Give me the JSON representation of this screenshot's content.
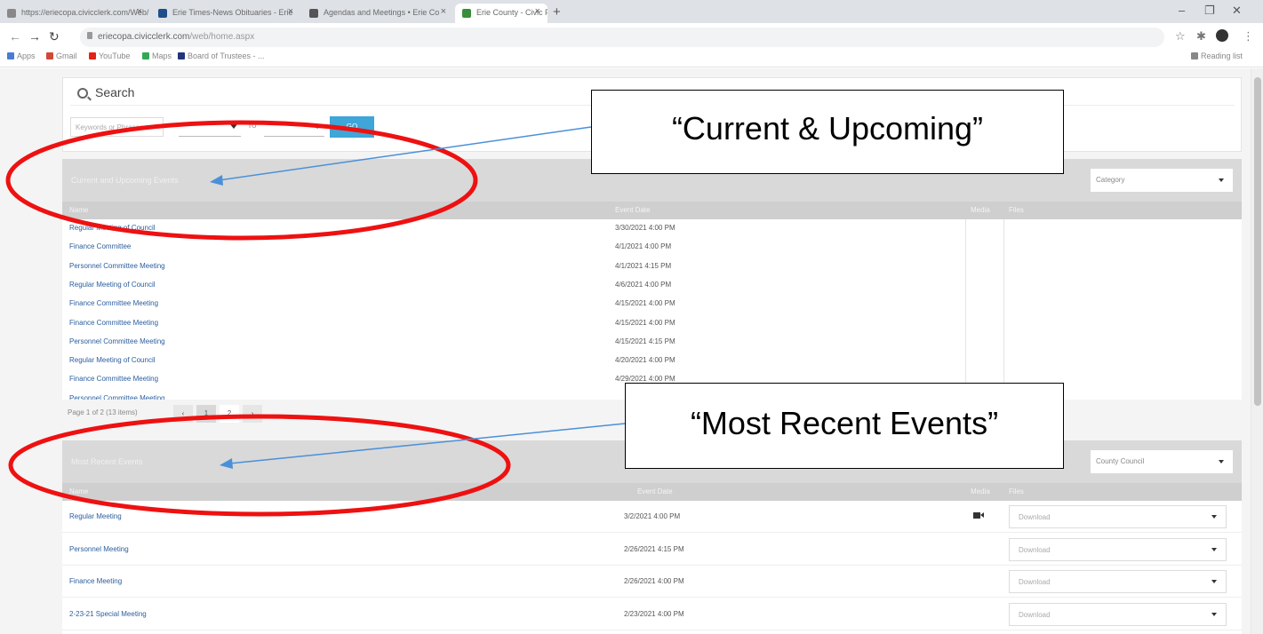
{
  "browser": {
    "tabs": [
      {
        "label": "https://eriecopa.civicclerk.com/Web/",
        "fav": "#888888"
      },
      {
        "label": "Erie Times-News Obituaries - Erie",
        "fav": "#1f4e8c"
      },
      {
        "label": "Agendas and Meetings • Erie Co",
        "fav": "#555555"
      },
      {
        "label": "Erie County - Civic Plus",
        "fav": "#3a8d3a"
      }
    ],
    "new_tab": "+",
    "win_min": "–",
    "win_max": "❐",
    "win_close": "✕",
    "url_prefix": "eriecopa.civicclerk.com",
    "url_path": "/web/home.aspx",
    "bookmarks": [
      {
        "label": "Apps",
        "color": "#4a7bd4"
      },
      {
        "label": "Gmail",
        "color": "#d44638"
      },
      {
        "label": "YouTube",
        "color": "#e62117"
      },
      {
        "label": "Maps",
        "color": "#34a853"
      },
      {
        "label": "Board of Trustees - ...",
        "color": "#22357a"
      }
    ],
    "reading_list": "Reading list"
  },
  "search": {
    "title": "Search",
    "keyword_placeholder": "Keywords or Phrases",
    "to_label": "To",
    "go_label": "GO"
  },
  "upcoming": {
    "title": "Current and Upcoming Events",
    "category_label": "Category",
    "columns": {
      "name": "Name",
      "date": "Event Date",
      "media": "Media",
      "files": "Files"
    },
    "rows": [
      {
        "name": "Regular Meeting of Council",
        "date": "3/30/2021 4:00 PM"
      },
      {
        "name": "Finance Committee",
        "date": "4/1/2021 4:00 PM"
      },
      {
        "name": "Personnel Committee Meeting",
        "date": "4/1/2021 4:15 PM"
      },
      {
        "name": "Regular Meeting of Council",
        "date": "4/6/2021 4:00 PM"
      },
      {
        "name": "Finance Committee Meeting",
        "date": "4/15/2021 4:00 PM"
      },
      {
        "name": "Finance Committee Meeting",
        "date": "4/15/2021 4:00 PM"
      },
      {
        "name": "Personnel Committee Meeting",
        "date": "4/15/2021 4:15 PM"
      },
      {
        "name": "Regular Meeting of Council",
        "date": "4/20/2021 4:00 PM"
      },
      {
        "name": "Finance Committee Meeting",
        "date": "4/29/2021 4:00 PM"
      },
      {
        "name": "Personnel Committee Meeting",
        "date": ""
      }
    ],
    "pager": {
      "info": "Page 1 of 2 (13 items)",
      "current": "1",
      "next_page": "2",
      "next": "›"
    }
  },
  "recent": {
    "title": "Most Recent Events",
    "category_label": "County Council",
    "columns": {
      "name": "Name",
      "date": "Event Date",
      "media": "Media",
      "files": "Files"
    },
    "download_label": "Download",
    "rows": [
      {
        "name": "Regular Meeting",
        "date": "3/2/2021 4:00 PM",
        "video": true
      },
      {
        "name": "Personnel Meeting",
        "date": "2/26/2021 4:15 PM",
        "video": false
      },
      {
        "name": "Finance Meeting",
        "date": "2/26/2021 4:00 PM",
        "video": false
      },
      {
        "name": "2-23-21 Special Meeting",
        "date": "2/23/2021 4:00 PM",
        "video": false
      }
    ]
  },
  "annotations": {
    "callout_upcoming": "“Current & Upcoming”",
    "callout_recent": "“Most Recent Events”",
    "ellipse_color": "#ee1111",
    "arrow_color": "#4a90d9"
  }
}
